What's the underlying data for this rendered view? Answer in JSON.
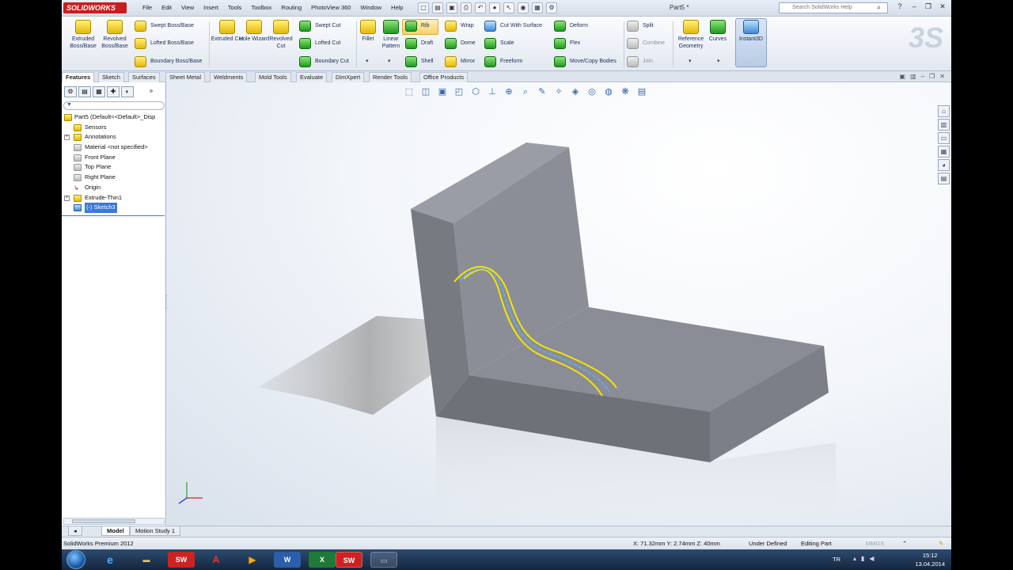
{
  "app": {
    "logo": "SOLIDWORKS",
    "doc_title": "Part5 *",
    "menus": [
      "File",
      "Edit",
      "View",
      "Insert",
      "Tools",
      "Toolbox",
      "Routing",
      "PhotoView 360",
      "Window",
      "Help"
    ],
    "search_placeholder": "Search SolidWorks Help"
  },
  "ribbon": {
    "extruded_boss": "Extruded Boss/Base",
    "revolved_boss": "Revolved Boss/Base",
    "swept_boss": "Swept Boss/Base",
    "lofted_boss": "Lofted Boss/Base",
    "boundary_boss": "Boundary Boss/Base",
    "extruded_cut": "Extruded Cut",
    "hole_wizard": "Hole Wizard",
    "revolved_cut": "Revolved Cut",
    "swept_cut": "Swept Cut",
    "lofted_cut": "Lofted Cut",
    "boundary_cut": "Boundary Cut",
    "fillet": "Fillet",
    "linear_pattern": "Linear Pattern",
    "rib": "Rib",
    "draft": "Draft",
    "shell": "Shell",
    "wrap": "Wrap",
    "dome": "Dome",
    "mirror": "Mirror",
    "cut_with_surface": "Cut With Surface",
    "scale": "Scale",
    "freeform": "Freeform",
    "deform": "Deform",
    "flex": "Flex",
    "move_copy": "Move/Copy Bodies",
    "split": "Split",
    "combine": "Combine",
    "join": "Join",
    "reference_geometry": "Reference Geometry",
    "curves": "Curves",
    "instant3d": "Instant3D"
  },
  "command_tabs": [
    "Features",
    "Sketch",
    "Surfaces",
    "Sheet Metal",
    "Weldments",
    "Mold Tools",
    "Evaluate",
    "DimXpert",
    "Render Tools",
    "Office Products"
  ],
  "tree": {
    "root": "Part5  (Default<<Default>_Disp",
    "items": [
      "Sensors",
      "Annotations",
      "Material <not specified>",
      "Front Plane",
      "Top Plane",
      "Right Plane",
      "Origin",
      "Extrude-Thin1",
      "(-) Sketch3"
    ],
    "selected_index": 8
  },
  "bottom_tabs": [
    "Model",
    "Motion Study 1"
  ],
  "status": {
    "product": "SolidWorks Premium 2012",
    "coords": "X: 71.32mm Y: 2.74mm Z: 40mm",
    "definition": "Under Defined",
    "mode": "Editing Part",
    "units": "MMGS"
  },
  "taskbar": {
    "lang": "TR",
    "time": "15:12",
    "date": "13.04.2014"
  },
  "colors": {
    "accent": "#3a78d8",
    "sketch_curve": "#f5e400",
    "sketch_center": "#6aa8e8",
    "model_face": "#8a8d96"
  }
}
